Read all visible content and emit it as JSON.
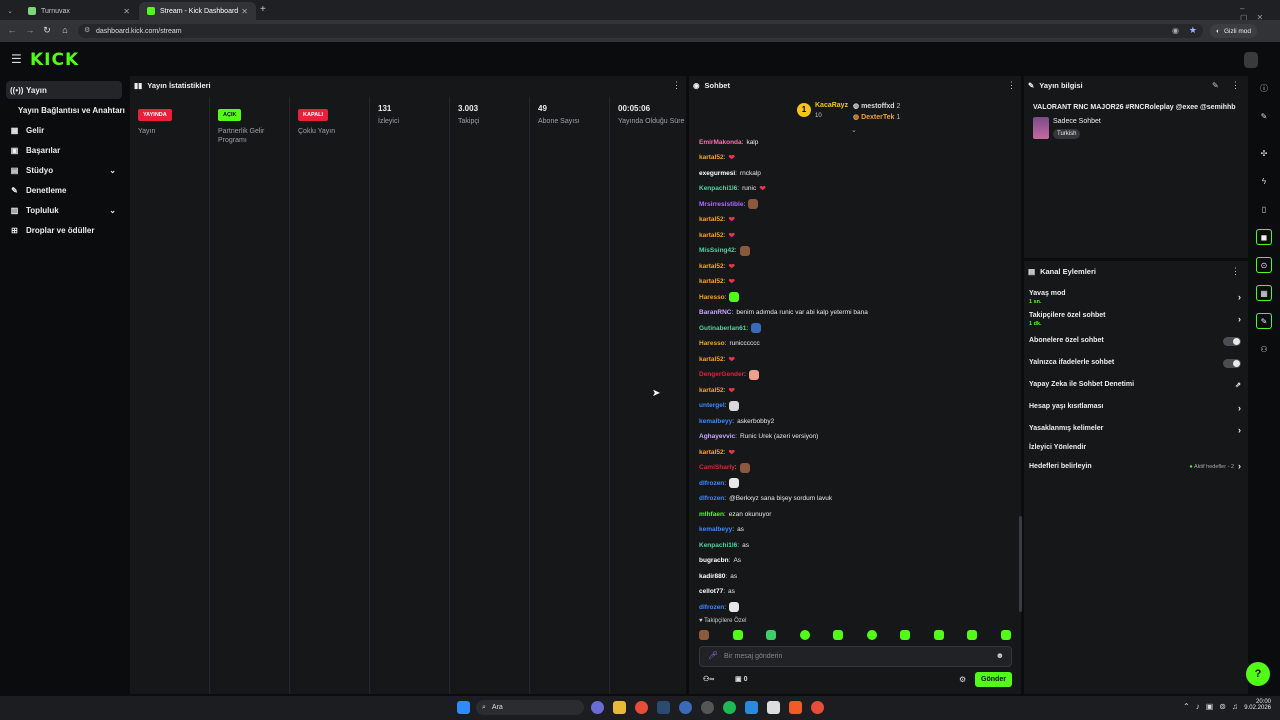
{
  "browser": {
    "tabs": [
      {
        "title": "Turnuvax",
        "favicon_color": "#7fd67a"
      },
      {
        "title": "Stream - Kick Dashboard",
        "favicon_color": "#53fc18"
      }
    ],
    "url": "dashboard.kick.com/stream",
    "incognito_label": "Gizli mod"
  },
  "brand": {
    "logo": "KICK",
    "accent": "#53fc18"
  },
  "nav": {
    "items": [
      {
        "label": "Yayın",
        "icon": "broadcast-icon"
      },
      {
        "label": "Yayın Bağlantısı ve Anahtarı",
        "icon": ""
      },
      {
        "label": "Gelir",
        "icon": "money-icon"
      },
      {
        "label": "Başarılar",
        "icon": "trophy-icon"
      },
      {
        "label": "Stüdyo",
        "icon": "studio-icon"
      },
      {
        "label": "Denetleme",
        "icon": "wrench-icon"
      },
      {
        "label": "Topluluk",
        "icon": "community-icon"
      },
      {
        "label": "Droplar ve ödüller",
        "icon": "gift-icon"
      }
    ]
  },
  "stats": {
    "title": "Yayın İstatistikleri",
    "columns": [
      {
        "badge": "YAYINDA",
        "label": "Yayın",
        "badge_color": "#e8203a"
      },
      {
        "badge": "AÇIK",
        "label": "Partnerlik Gelir Programı",
        "badge_color": "#53fc18"
      },
      {
        "badge": "KAPALI",
        "label": "Çoklu Yayın",
        "badge_color": "#e8203a"
      },
      {
        "value": "131",
        "label": "İzleyici"
      },
      {
        "value": "3.003",
        "label": "Takipçi"
      },
      {
        "value": "49",
        "label": "Abone Sayısı"
      },
      {
        "value": "00:05:06",
        "label": "Yayında Olduğu Süre"
      }
    ]
  },
  "chat": {
    "title": "Sohbet",
    "top_gifters": [
      {
        "name": "KacaRayz",
        "count": "10"
      },
      {
        "name": "mestoffxd",
        "count": "2"
      },
      {
        "name": "DexterTek",
        "count": "1"
      }
    ],
    "messages": [
      {
        "user": "EmirMakonda",
        "color": "#ff6fb1",
        "text": "kalp"
      },
      {
        "user": "kartal52",
        "color": "#f5a623",
        "text": "",
        "emote": "heart"
      },
      {
        "user": "exegurmesi",
        "color": "#ffffff",
        "text": "rnckalp"
      },
      {
        "user": "Kenpachi1l6",
        "color": "#4dd6a0",
        "text": "runic",
        "emote": "heart"
      },
      {
        "user": "Mrsirresistible",
        "color": "#b06bff",
        "text": "",
        "emote": "face"
      },
      {
        "user": "kartal52",
        "color": "#f5a623",
        "text": "",
        "emote": "heart"
      },
      {
        "user": "kartal52",
        "color": "#f5a623",
        "text": "",
        "emote": "heart"
      },
      {
        "user": "MisSsing42",
        "color": "#4dd6a0",
        "text": "",
        "emote": "face"
      },
      {
        "user": "kartal52",
        "color": "#f5a623",
        "text": "",
        "emote": "heart"
      },
      {
        "user": "kartal52",
        "color": "#f5a623",
        "text": "",
        "emote": "heart"
      },
      {
        "user": "Haresso",
        "color": "#f5a623",
        "text": "",
        "emote": "ghost"
      },
      {
        "user": "BaranRNC",
        "color": "#c9a6ff",
        "text": "benim adımda runic var abi kalp yetermi bana"
      },
      {
        "user": "Gutinaberlan61",
        "color": "#4dd6a0",
        "text": "",
        "emote": "cake"
      },
      {
        "user": "Haresso",
        "color": "#f5a623",
        "text": "runicccccc"
      },
      {
        "user": "kartal52",
        "color": "#f5a623",
        "text": "",
        "emote": "heart"
      },
      {
        "user": "DengerGender",
        "color": "#e8203a",
        "text": "",
        "emote": "hand"
      },
      {
        "user": "kartal52",
        "color": "#f5a623",
        "text": "",
        "emote": "heart"
      },
      {
        "user": "untergel",
        "color": "#3b8bff",
        "text": "",
        "emote": "gyy"
      },
      {
        "user": "kemalbeyy",
        "color": "#3b8bff",
        "text": "askerbobby2"
      },
      {
        "user": "Aghayevvic",
        "color": "#c9a6ff",
        "text": "Runic Urek (azeri versiyon)"
      },
      {
        "user": "kartal52",
        "color": "#f5a623",
        "text": "",
        "emote": "heart"
      },
      {
        "user": "CamiSharly",
        "color": "#e8203a",
        "text": "",
        "emote": "face"
      },
      {
        "user": "dlfrozen",
        "color": "#3b8bff",
        "text": "",
        "emote": "ghostw"
      },
      {
        "user": "dlfrozen",
        "color": "#3b8bff",
        "text": "@Berkxyz sana bişey sordum lavuk"
      },
      {
        "user": "mlhfaen",
        "color": "#53fc18",
        "text": "ezan okunuyor"
      },
      {
        "user": "kemalbeyy",
        "color": "#3b8bff",
        "text": "as"
      },
      {
        "user": "Kenpachi1l6",
        "color": "#4dd6a0",
        "text": "as"
      },
      {
        "user": "bugracbn",
        "color": "#ffffff",
        "text": "As"
      },
      {
        "user": "kadir880",
        "color": "#ffffff",
        "text": "as"
      },
      {
        "user": "cellot77",
        "color": "#ffffff",
        "text": "as"
      },
      {
        "user": "dlfrozen",
        "color": "#3b8bff",
        "text": "",
        "emote": "ghostw"
      }
    ],
    "followers_only_label": "Takipçilere Özel",
    "input_placeholder": "Bir mesaj gönderin",
    "infinity_label": "∞",
    "points_value": "0",
    "send_label": "Gönder"
  },
  "stream_info": {
    "title": "Yayın bilgisi",
    "stream_title": "VALORANT RNC MAJOR26 #RNCRoleplay @exee @semihhb",
    "category": "Sadece Sohbet",
    "language": "Turkish"
  },
  "channel_actions": {
    "title": "Kanal Eylemleri",
    "rows": [
      {
        "label": "Yavaş mod",
        "sub": "1 sn.",
        "control": "chevron"
      },
      {
        "label": "Takipçilere özel sohbet",
        "sub": "1 dk.",
        "control": "chevron"
      },
      {
        "label": "Abonelere özel sohbet",
        "sub": "",
        "control": "toggle"
      },
      {
        "label": "Yalnızca ifadelerle sohbet",
        "sub": "",
        "control": "toggle"
      },
      {
        "label": "Yapay Zeka ile Sohbet Denetimi",
        "sub": "",
        "control": "external"
      },
      {
        "label": "Hesap yaşı kısıtlaması",
        "sub": "",
        "control": "chevron"
      },
      {
        "label": "Yasaklanmış kelimeler",
        "sub": "",
        "control": "chevron"
      },
      {
        "label": "İzleyici Yönlendir",
        "sub": "",
        "control": "none"
      },
      {
        "label": "Hedefleri belirleyin",
        "sub": "",
        "control": "chevron",
        "note": "Aktif hedefler - 2"
      }
    ]
  },
  "taskbar": {
    "search_label": "Ara",
    "time": "20:00",
    "date": "9.02.2026"
  }
}
